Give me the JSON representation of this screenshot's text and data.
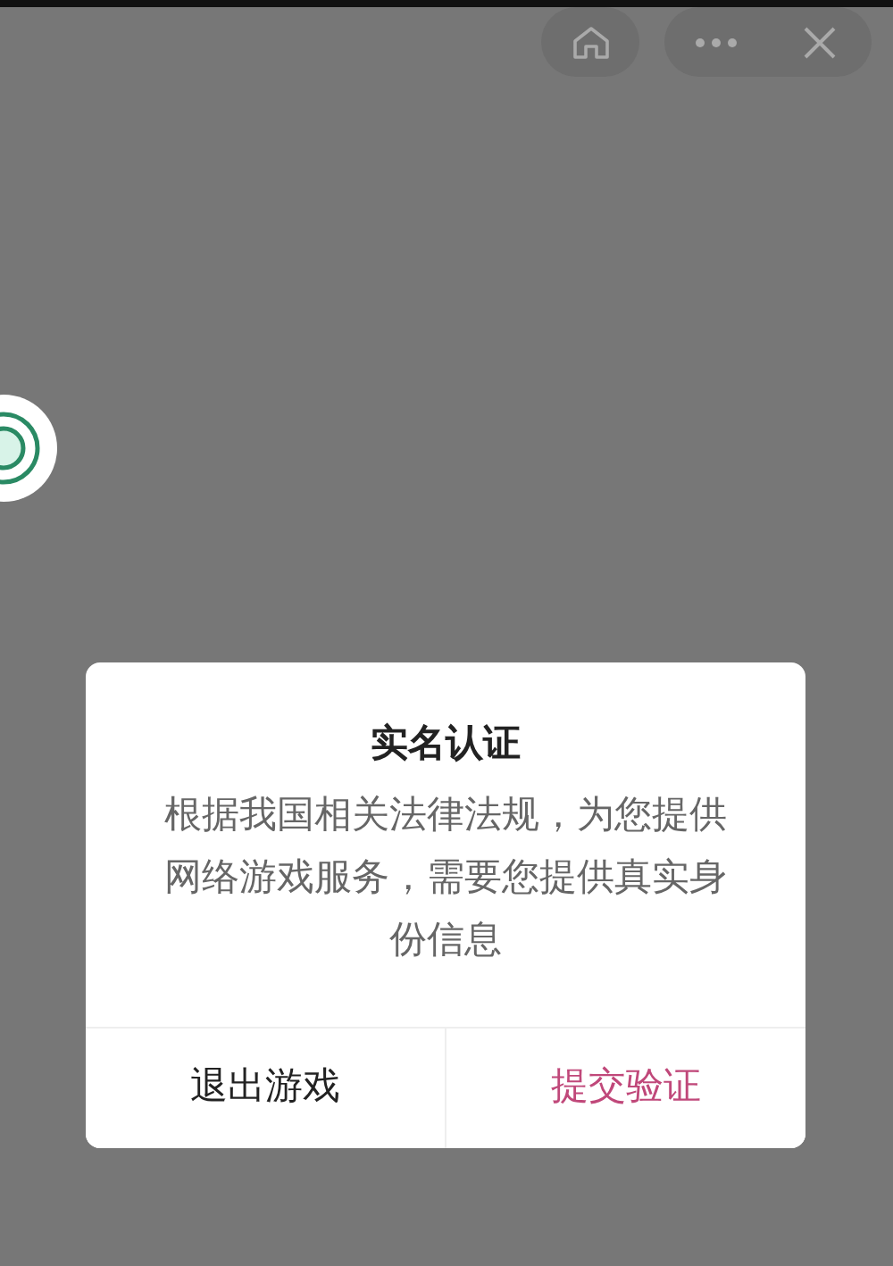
{
  "dialog": {
    "title": "实名认证",
    "message": "根据我国相关法律法规，为您提供网络游戏服务，需要您提供真实身份信息",
    "buttons": [
      {
        "label": "退出游戏",
        "kind": "cancel"
      },
      {
        "label": "提交验证",
        "kind": "confirm"
      }
    ]
  }
}
